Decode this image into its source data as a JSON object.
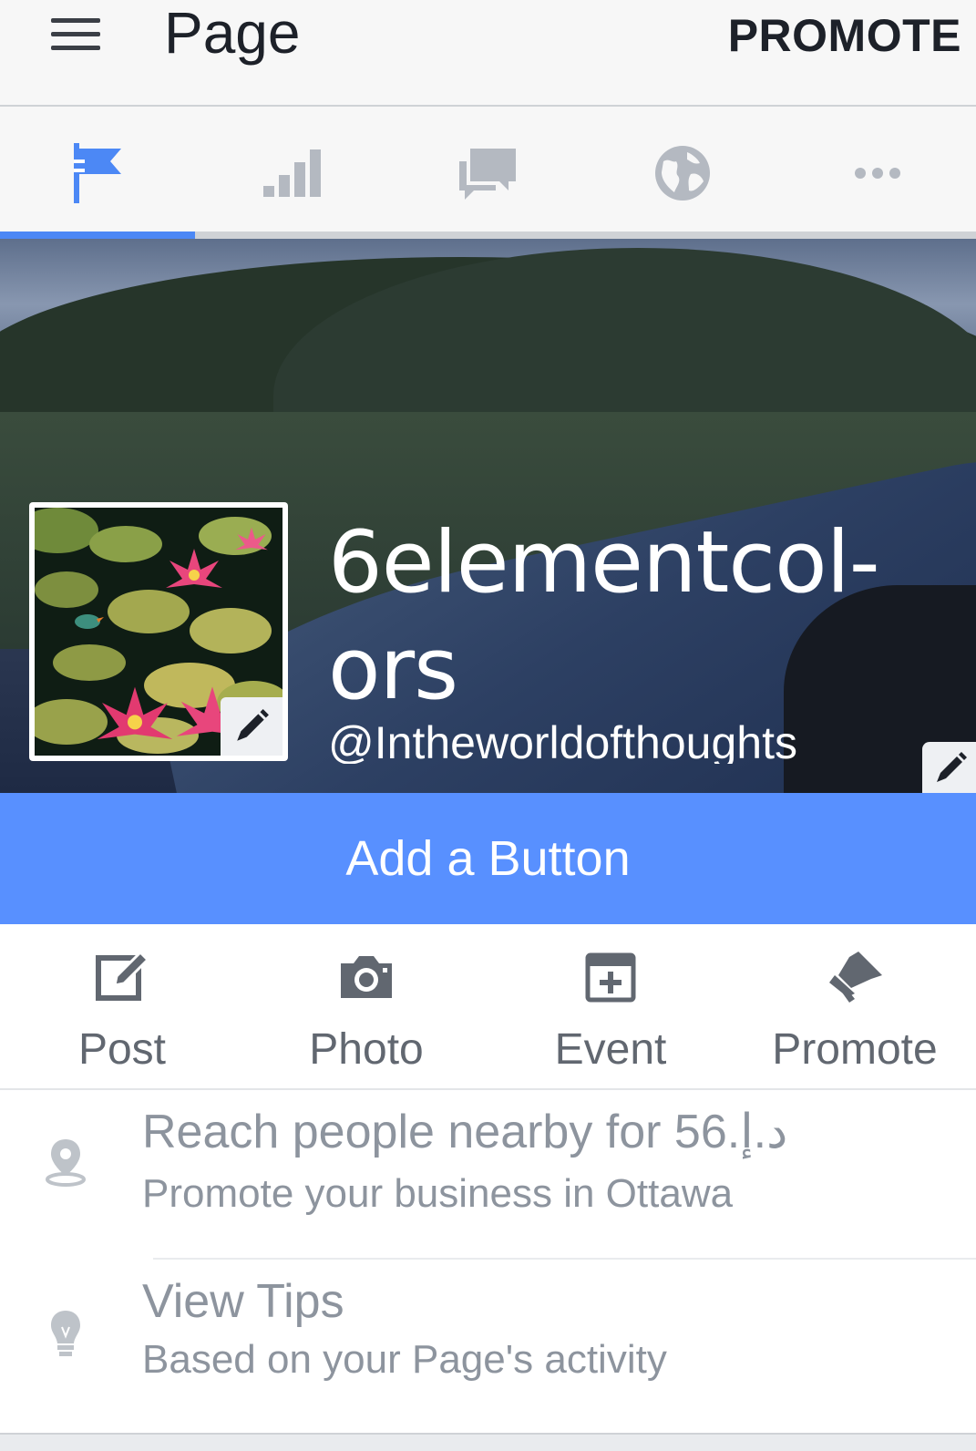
{
  "header": {
    "title": "Page",
    "promote_label": "PROMOTE"
  },
  "tabs": [
    {
      "icon": "flag-icon",
      "active": true
    },
    {
      "icon": "bar-chart-icon",
      "active": false
    },
    {
      "icon": "chat-bubbles-icon",
      "active": false
    },
    {
      "icon": "globe-icon",
      "active": false
    },
    {
      "icon": "more-dots-icon",
      "active": false
    }
  ],
  "profile": {
    "name": "6elementcol-ors",
    "name_line1": "6elementcol-",
    "name_line2": "ors",
    "handle": "@Intheworldofthoughts"
  },
  "cta": {
    "label": "Add a Button"
  },
  "actions": [
    {
      "label": "Post",
      "icon": "edit-icon"
    },
    {
      "label": "Photo",
      "icon": "camera-icon"
    },
    {
      "label": "Event",
      "icon": "calendar-plus-icon"
    },
    {
      "label": "Promote",
      "icon": "megaphone-icon"
    }
  ],
  "list": [
    {
      "icon": "location-pin-icon",
      "title": "Reach people nearby for 56.د.إ",
      "subtitle": "Promote your business in Ottawa"
    },
    {
      "icon": "lightbulb-icon",
      "title": "View Tips",
      "subtitle": "Based on your Page's activity"
    }
  ],
  "colors": {
    "accent": "#4c88f5",
    "button_blue": "#5890ff",
    "icon_gray": "#616770",
    "text_gray": "#8d949e"
  }
}
